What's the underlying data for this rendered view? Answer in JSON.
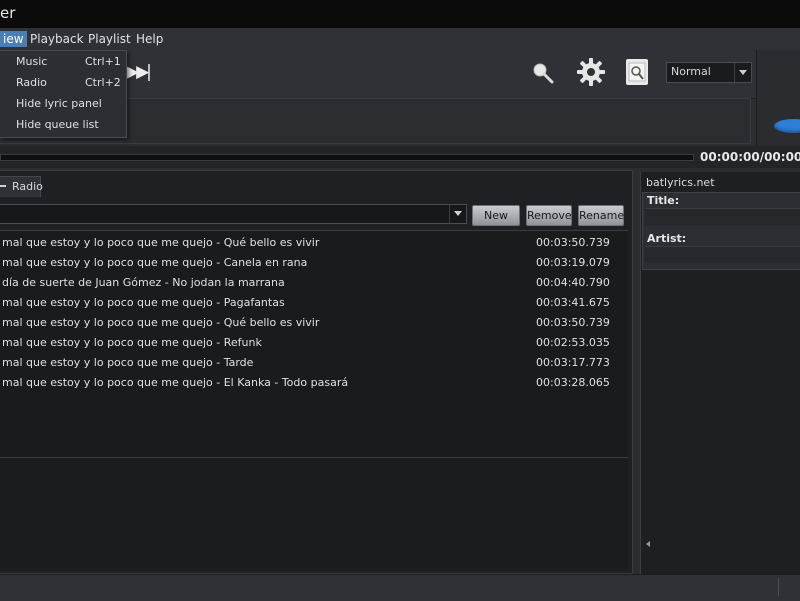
{
  "window": {
    "title": "er"
  },
  "menubar": {
    "items": [
      {
        "label": "iew",
        "active": true
      },
      {
        "label": "Playback"
      },
      {
        "label": "Playlist"
      },
      {
        "label": "Help"
      }
    ]
  },
  "view_menu": {
    "items": [
      {
        "label": "Music",
        "shortcut": "Ctrl+1"
      },
      {
        "label": "Radio",
        "shortcut": "Ctrl+2"
      },
      {
        "label": "Hide lyric panel",
        "shortcut": ""
      },
      {
        "label": "Hide queue list",
        "shortcut": ""
      }
    ]
  },
  "toolbar": {
    "next_icon": "skip-next-icon",
    "mode_select": {
      "value": "Normal"
    },
    "icons": [
      "search-icon",
      "gear-icon",
      "lyrics-icon"
    ]
  },
  "player": {
    "time": "00:00:00/00:00:"
  },
  "tabs": {
    "radio_label": "Radio"
  },
  "playlist_controls": {
    "new_label": "New",
    "remove_label": "Remove",
    "rename_label": "Rename"
  },
  "tracks": [
    {
      "title": "mal que estoy y lo poco que me quejo - Qué bello es vivir",
      "duration": "00:03:50.739"
    },
    {
      "title": "mal que estoy y lo poco que me quejo - Canela en rana",
      "duration": "00:03:19.079"
    },
    {
      "title": "día de suerte de Juan Gómez - No jodan la marrana",
      "duration": "00:04:40.790"
    },
    {
      "title": "mal que estoy y lo poco que me quejo - Pagafantas",
      "duration": "00:03:41.675"
    },
    {
      "title": "mal que estoy y lo poco que me quejo - Qué bello es vivir",
      "duration": "00:03:50.739"
    },
    {
      "title": "mal que estoy y lo poco que me quejo - Refunk",
      "duration": "00:02:53.035"
    },
    {
      "title": "mal que estoy y lo poco que me quejo - Tarde",
      "duration": "00:03:17.773"
    },
    {
      "title": "mal que estoy y lo poco que me quejo - El Kanka - Todo pasará",
      "duration": "00:03:28.065"
    }
  ],
  "lyrics": {
    "source": "batlyrics.net",
    "title_label": "Title:",
    "artist_label": "Artist:"
  },
  "colors": {
    "accent": "#4a7fb5",
    "oval": "#2f7ed8",
    "background": "#2b2d31"
  }
}
